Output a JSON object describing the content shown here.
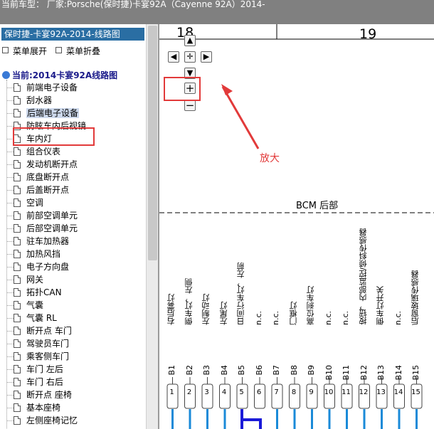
{
  "header": {
    "title": "当前车型：  厂家:Porsche(保时捷)卡宴92A（Cayenne 92A）2014-"
  },
  "sidebar": {
    "title": "保时捷-卡宴92A-2014-线路图",
    "expand_label": "菜单展开",
    "collapse_label": "菜单折叠",
    "root_label": "当前:2014卡宴92A线路图",
    "items": [
      {
        "label": "前端电子设备"
      },
      {
        "label": "刮水器"
      },
      {
        "label": "后端电子设备",
        "selected": true
      },
      {
        "label": "防眩车内后视镜"
      },
      {
        "label": "车内灯"
      },
      {
        "label": "组合仪表"
      },
      {
        "label": "发动机断开点"
      },
      {
        "label": "底盘断开点"
      },
      {
        "label": "后盖断开点"
      },
      {
        "label": "空调"
      },
      {
        "label": "前部空调单元"
      },
      {
        "label": "后部空调单元"
      },
      {
        "label": "驻车加热器"
      },
      {
        "label": "加热风挡"
      },
      {
        "label": "电子方向盘"
      },
      {
        "label": "网关"
      },
      {
        "label": "拓扑CAN"
      },
      {
        "label": "气囊"
      },
      {
        "label": "气囊 RL"
      },
      {
        "label": "断开点 车门"
      },
      {
        "label": "驾驶员车门"
      },
      {
        "label": "乘客侧车门"
      },
      {
        "label": "车门 左后"
      },
      {
        "label": "车门 右后"
      },
      {
        "label": "断开点 座椅"
      },
      {
        "label": "基本座椅"
      },
      {
        "label": "左侧座椅记忆"
      }
    ]
  },
  "diagram": {
    "columns": [
      "18",
      "19"
    ],
    "bcm_label": "BCM 后部",
    "zoom_annotation": "放大",
    "nav_icons": {
      "up": "arrow-up-icon",
      "left": "arrow-left-icon",
      "center": "move-icon",
      "right": "arrow-right-icon",
      "down": "arrow-down-icon",
      "zoom_in": "plus-icon",
      "zoom_out": "minus-icon"
    },
    "pins": [
      {
        "label": "右后雾灯",
        "pin": "B1",
        "num": "1"
      },
      {
        "label": "倒车灯，左侧",
        "pin": "B2",
        "num": "2"
      },
      {
        "label": "左制动灯",
        "pin": "B3",
        "num": "3"
      },
      {
        "label": "左尾灯",
        "pin": "B4",
        "num": "4"
      },
      {
        "label": "日间行车灯，左前",
        "pin": "B5",
        "num": "5"
      },
      {
        "label": "n.c.",
        "pin": "B6",
        "num": "6"
      },
      {
        "label": "n.c.",
        "pin": "B7",
        "num": "7"
      },
      {
        "label": "门框灯",
        "pin": "B8",
        "num": "8"
      },
      {
        "label": "高位刹车灯",
        "pin": "B9",
        "num": "9"
      },
      {
        "label": "n.c.",
        "pin": "B10",
        "num": "10"
      },
      {
        "label": "n.c.",
        "pin": "B11",
        "num": "11"
      },
      {
        "label": "按钮，内部监控/倾斜传感器",
        "pin": "B12",
        "num": "12"
      },
      {
        "label": "倒车灯开关",
        "pin": "B13",
        "num": "13"
      },
      {
        "label": "n.c.",
        "pin": "B14",
        "num": "14"
      },
      {
        "label": "后窗玻璃传感器",
        "pin": "B15",
        "num": "15"
      }
    ]
  },
  "colors": {
    "header_bg": "#808080",
    "sidebar_title_bg": "#2a6ea3",
    "annotation_red": "#e23a3a",
    "wire_blue": "#1a8ad8"
  }
}
